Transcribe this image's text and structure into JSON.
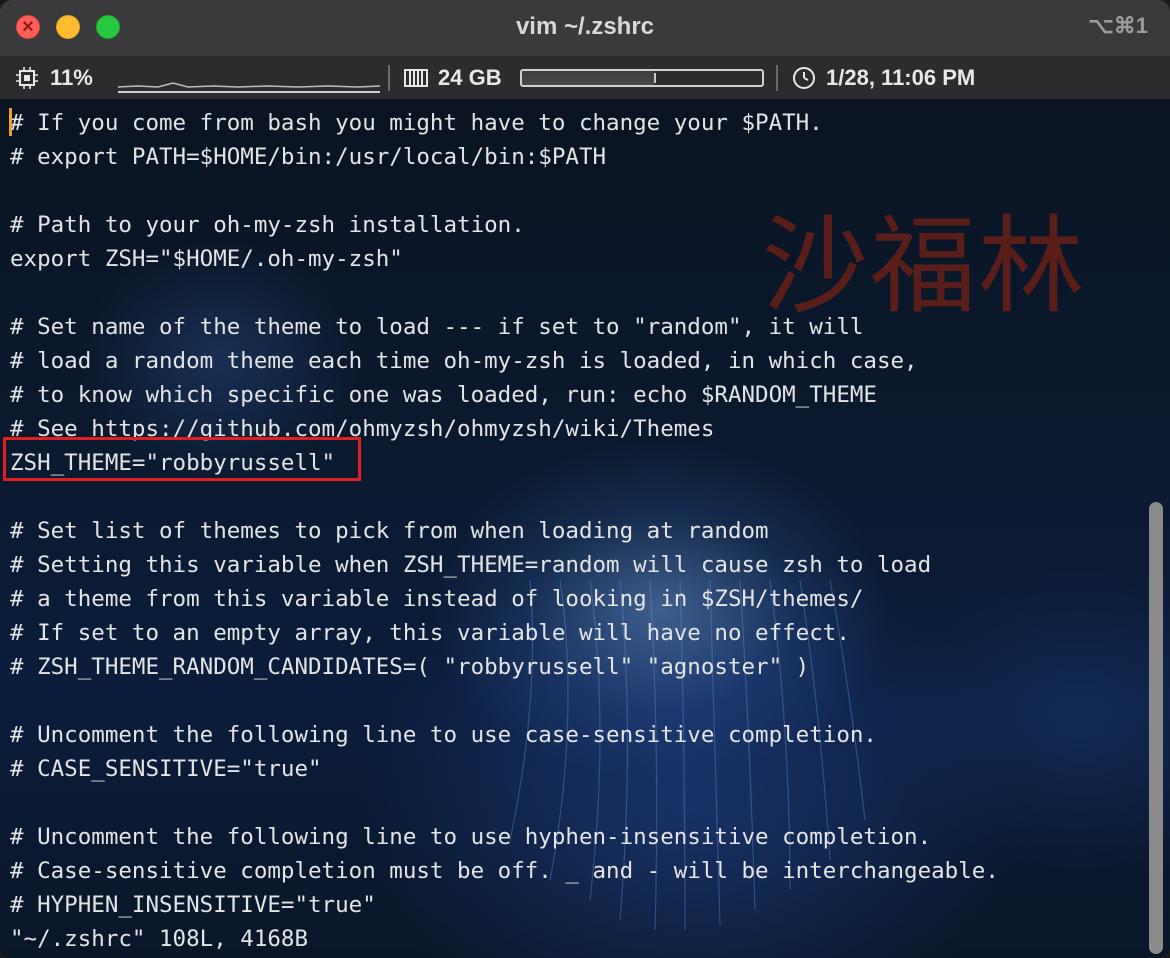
{
  "window": {
    "title": "vim ~/.zshrc",
    "shortcut": "⌥⌘1"
  },
  "status_bar": {
    "cpu": "11%",
    "memory": "24 GB",
    "memory_used_fraction": 0.55,
    "datetime": "1/28, 11:06 PM"
  },
  "editor": {
    "watermark": "沙福林",
    "lines": [
      "# If you come from bash you might have to change your $PATH.",
      "# export PATH=$HOME/bin:/usr/local/bin:$PATH",
      "",
      "# Path to your oh-my-zsh installation.",
      "export ZSH=\"$HOME/.oh-my-zsh\"",
      "",
      "# Set name of the theme to load --- if set to \"random\", it will",
      "# load a random theme each time oh-my-zsh is loaded, in which case,",
      "# to know which specific one was loaded, run: echo $RANDOM_THEME",
      "# See https://github.com/ohmyzsh/ohmyzsh/wiki/Themes",
      "ZSH_THEME=\"robbyrussell\"",
      "",
      "# Set list of themes to pick from when loading at random",
      "# Setting this variable when ZSH_THEME=random will cause zsh to load",
      "# a theme from this variable instead of looking in $ZSH/themes/",
      "# If set to an empty array, this variable will have no effect.",
      "# ZSH_THEME_RANDOM_CANDIDATES=( \"robbyrussell\" \"agnoster\" )",
      "",
      "# Uncomment the following line to use case-sensitive completion.",
      "# CASE_SENSITIVE=\"true\"",
      "",
      "# Uncomment the following line to use hyphen-insensitive completion.",
      "# Case-sensitive completion must be off. _ and - will be interchangeable.",
      "# HYPHEN_INSENSITIVE=\"true\"",
      "\"~/.zshrc\" 108L, 4168B"
    ]
  },
  "colors": {
    "highlight_border": "#e02020",
    "watermark": "#5a1e1a",
    "cursor": "#f0a030"
  }
}
